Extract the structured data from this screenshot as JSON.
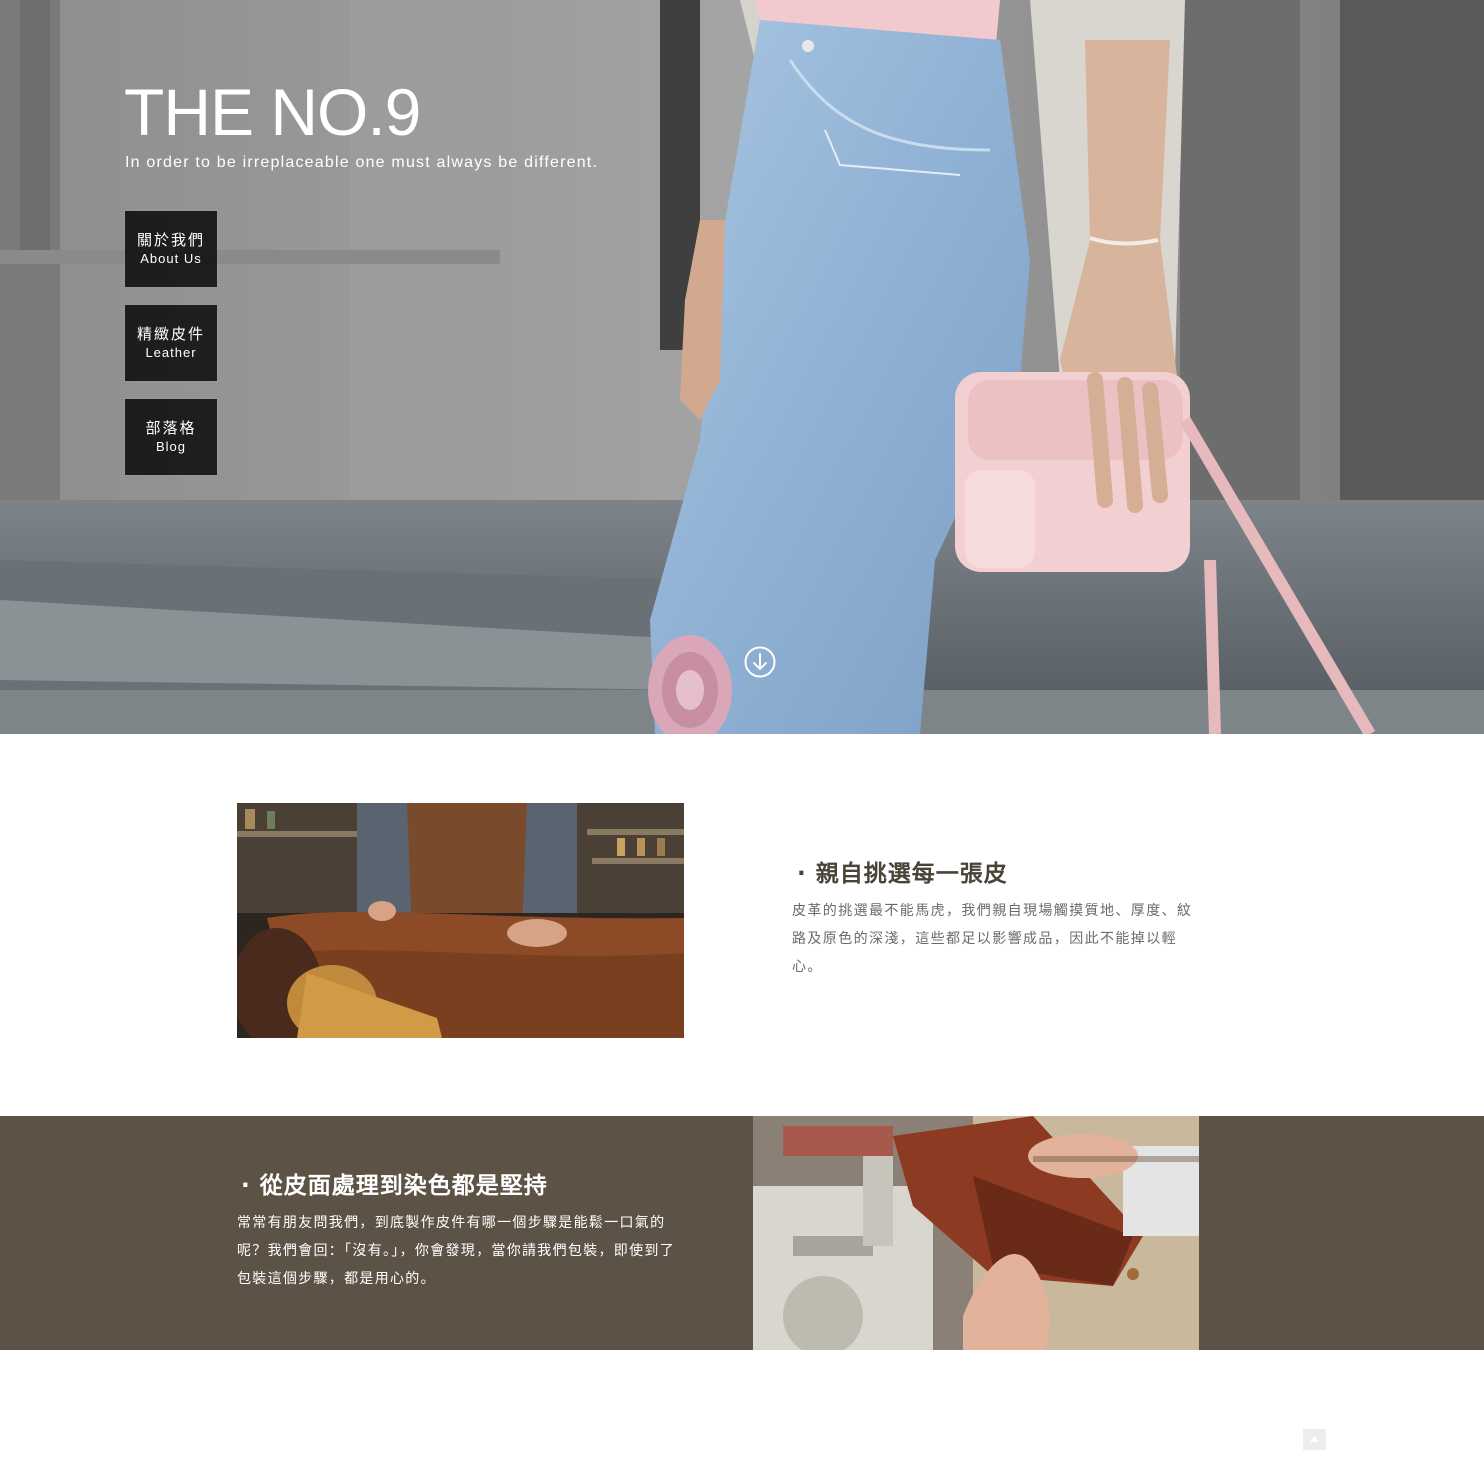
{
  "hero": {
    "title": "THE NO.9",
    "tagline": "In order to be irreplaceable one must always be different."
  },
  "nav": [
    {
      "zh": "關於我們",
      "en": "About Us"
    },
    {
      "zh": "精緻皮件",
      "en": "Leather"
    },
    {
      "zh": "部落格",
      "en": "Blog"
    }
  ],
  "features": [
    {
      "title": "· 親自挑選每一張皮",
      "body": "皮革的挑選最不能馬虎，我們親自現場觸摸質地、厚度、紋路及原色的深淺，這些都足以影響成品，因此不能掉以輕心。"
    },
    {
      "title": "· 從皮面處理到染色都是堅持",
      "body": "常常有朋友問我們，到底製作皮件有哪一個步驟是能鬆一口氣的呢？我們會回：「沒有。」，你會發現，當你請我們包裝，即使到了包裝這個步驟，都是用心的。"
    }
  ],
  "colors": {
    "feature_band": "#5c5346",
    "feature_title": "#4a4438",
    "nav_button": "#141414"
  },
  "icons": {
    "scroll": "arrow-down-circle-icon",
    "back_to_top": "chevron-up-icon"
  }
}
